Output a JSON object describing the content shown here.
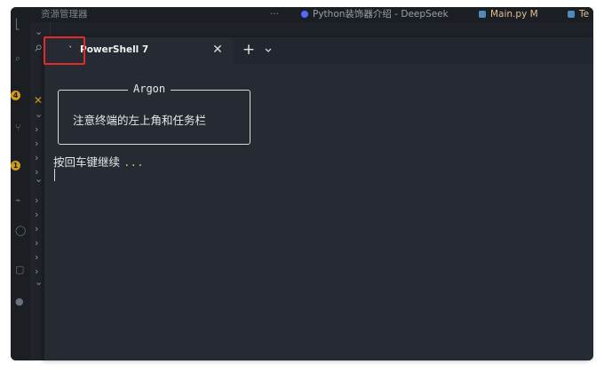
{
  "background_vscode": {
    "tabs": [
      {
        "label": "资源管理器",
        "color": "#8a909a"
      },
      {
        "label": "Python装饰器介绍 - DeepSeek",
        "color": "#8a909a"
      },
      {
        "label": "Main.py M",
        "color": "#e2c08d"
      },
      {
        "label": "Te",
        "color": "#e2c08d"
      }
    ],
    "more_label": "···",
    "badges": [
      "4",
      "1"
    ]
  },
  "terminal": {
    "tab_icon": "`",
    "tab_title": "PowerShell 7",
    "close_symbol": "✕",
    "add_symbol": "+",
    "dialog_title": "Argon",
    "dialog_message": "注意终端的左上角和任务栏",
    "prompt_text": "按回车键继续",
    "prompt_dots": "...",
    "accent_color": "#e0b84a",
    "highlight_color": "#e32b2b"
  }
}
